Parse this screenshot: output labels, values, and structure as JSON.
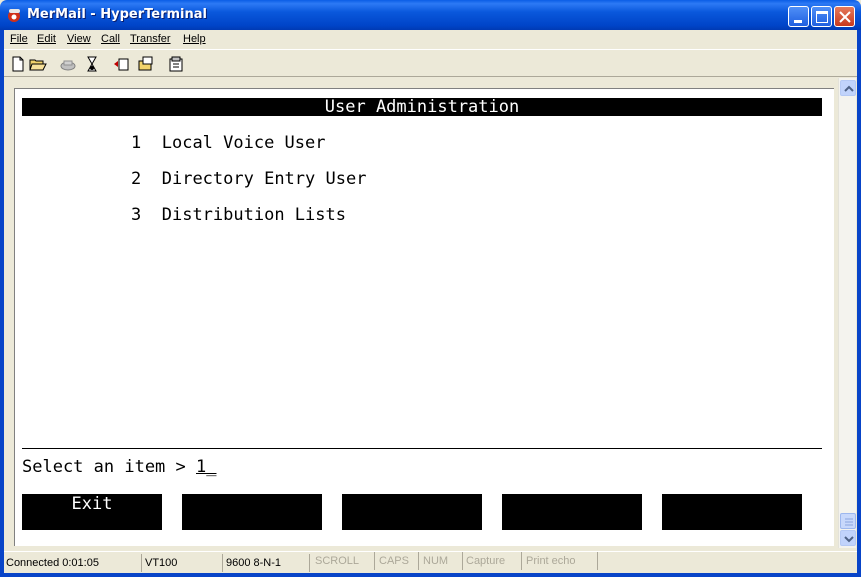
{
  "window": {
    "title": "MerMail - HyperTerminal"
  },
  "menubar": {
    "items": [
      {
        "label": "File",
        "key": "F"
      },
      {
        "label": "Edit",
        "key": "E"
      },
      {
        "label": "View",
        "key": "V"
      },
      {
        "label": "Call",
        "key": "C"
      },
      {
        "label": "Transfer",
        "key": "T"
      },
      {
        "label": "Help",
        "key": "H"
      }
    ]
  },
  "toolbar": {
    "icons": [
      "new-connection-icon",
      "open-icon",
      "connect-icon",
      "disconnect-icon",
      "send-icon",
      "receive-icon",
      "properties-icon"
    ]
  },
  "terminal": {
    "header": "User Administration",
    "menu": [
      {
        "number": "1",
        "label": "Local Voice User"
      },
      {
        "number": "2",
        "label": "Directory Entry User"
      },
      {
        "number": "3",
        "label": "Distribution Lists"
      }
    ],
    "prompt": "Select an item > ",
    "prompt_value": "1_",
    "function_keys": [
      "Exit",
      "",
      "",
      "",
      ""
    ]
  },
  "statusbar": {
    "connected": "Connected 0:01:05",
    "emulation": "VT100",
    "settings": "9600 8-N-1",
    "scroll": "SCROLL",
    "caps": "CAPS",
    "num": "NUM",
    "capture": "Capture",
    "print_echo": "Print echo"
  },
  "colors": {
    "title_bar": "#0a58dc",
    "terminal_bg": "#ffffff",
    "terminal_fg": "#000000",
    "chrome": "#ece9d8"
  }
}
